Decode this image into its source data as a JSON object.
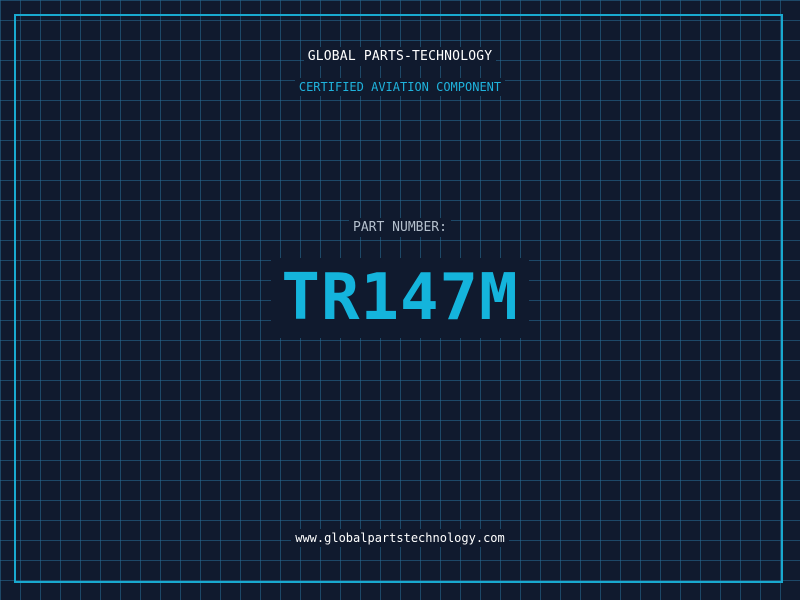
{
  "company_name": "GLOBAL PARTS-TECHNOLOGY",
  "subtitle": "CERTIFIED AVIATION COMPONENT",
  "part_label": "PART NUMBER:",
  "part_number": "TR147M",
  "website": "www.globalpartstechnology.com",
  "colors": {
    "background": "#101a2e",
    "grid": "#286e96",
    "frame": "#19a9cf",
    "accent": "#14b4dc",
    "label": "#b4bfcc",
    "title": "#ffffff"
  }
}
